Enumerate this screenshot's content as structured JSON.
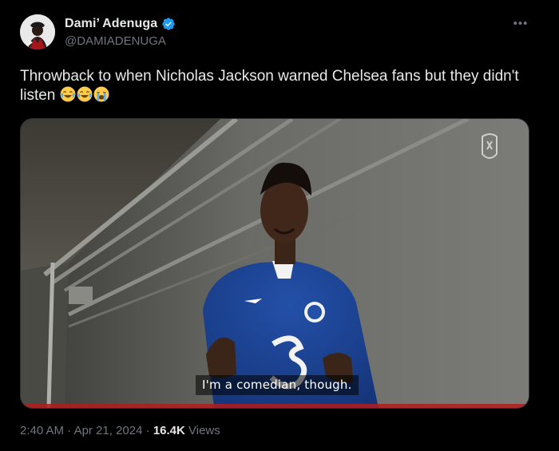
{
  "author": {
    "display_name": "Dami’ Adenuga",
    "handle": "@DAMIADENUGA",
    "verified": true
  },
  "tweet": {
    "text": "Throwback to when Nicholas Jackson warned Chelsea fans but they didn't listen",
    "emojis": [
      "face-with-tears-of-joy",
      "face-with-tears-of-joy",
      "loudly-crying-face"
    ]
  },
  "media": {
    "caption": "I'm a comedian, though."
  },
  "meta": {
    "time": "2:40 AM",
    "separator": "·",
    "date": "Apr 21, 2024",
    "views_count": "16.4K",
    "views_label": "Views"
  },
  "colors": {
    "background": "#000000",
    "text": "#e7e9ea",
    "secondary_text": "#71767b",
    "verified_badge": "#1d9bf0",
    "border": "#2f3336"
  }
}
